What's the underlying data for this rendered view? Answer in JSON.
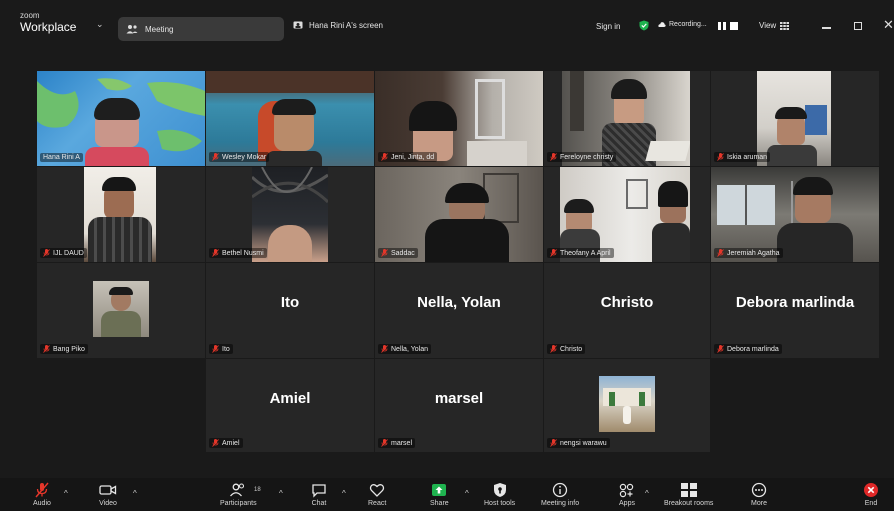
{
  "app": {
    "brand_top": "zoom",
    "brand_bottom": "Workplace"
  },
  "topbar": {
    "meeting_label": "Meeting",
    "share_label": "Hana Rini A's screen",
    "signin_label": "Sign in",
    "recording_label": "Recording...",
    "view_label": "View"
  },
  "tiles": [
    {
      "name": "Hana Rini A",
      "muted": false,
      "highlight": true
    },
    {
      "name": "Wesley Mokar",
      "muted": true
    },
    {
      "name": "Jeni, Jinta, dd",
      "muted": true
    },
    {
      "name": "Fereloyne christy",
      "muted": true
    },
    {
      "name": "Iskia aruman",
      "muted": true
    },
    {
      "name": "IJL DAUD",
      "muted": true
    },
    {
      "name": "Bethel Nusmi",
      "muted": true
    },
    {
      "name": "Saddac",
      "muted": true
    },
    {
      "name": "Theofany A April",
      "muted": true
    },
    {
      "name": "Jeremiah Agatha",
      "muted": true
    },
    {
      "name": "Bang Piko",
      "muted": true
    },
    {
      "name": "Ito",
      "display": "Ito",
      "muted": true
    },
    {
      "name": "Nella, Yolan",
      "display": "Nella, Yolan",
      "muted": true
    },
    {
      "name": "Christo",
      "display": "Christo",
      "muted": true
    },
    {
      "name": "Debora marlinda",
      "display": "Debora marlinda",
      "muted": true
    },
    {
      "name": "Amiel",
      "display": "Amiel",
      "muted": true
    },
    {
      "name": "marsel",
      "display": "marsel",
      "muted": true
    },
    {
      "name": "nengsi warawu",
      "muted": true
    }
  ],
  "toolbar": {
    "audio": "Audio",
    "video": "Video",
    "participants": "Participants",
    "participants_count": "18",
    "chat": "Chat",
    "react": "React",
    "share": "Share",
    "host_tools": "Host tools",
    "meeting_info": "Meeting info",
    "apps": "Apps",
    "breakout_rooms": "Breakout rooms",
    "more": "More",
    "end": "End"
  },
  "colors": {
    "share_green": "#1fb34f",
    "highlight_green": "#2dd05f",
    "end_red": "#e02828",
    "mute_red": "#e5362a"
  }
}
